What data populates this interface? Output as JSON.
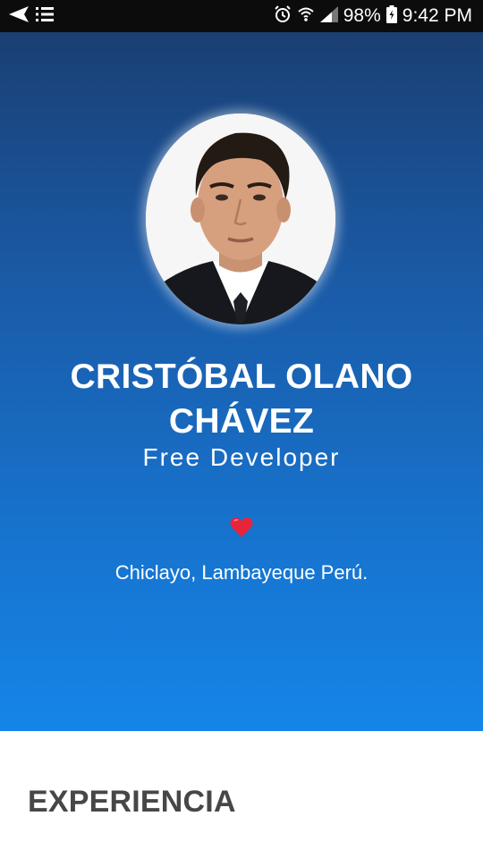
{
  "status_bar": {
    "battery": "98%",
    "time": "9:42 PM",
    "icons": [
      "send-icon",
      "list-icon",
      "alarm-icon",
      "wifi-icon",
      "signal-icon",
      "battery-icon"
    ]
  },
  "profile": {
    "name_line1": "CRISTÓBAL OLANO",
    "name_line2": "CHÁVEZ",
    "role": "Free Developer",
    "heart_icon": "heart-icon",
    "location": "Chiclayo, Lambayeque Perú."
  },
  "sections": {
    "experience_title": "EXPERIENCIA"
  },
  "colors": {
    "status_bar": "#0c0c0c",
    "hero_top": "#1a3f73",
    "hero_bottom": "#1585e8",
    "heart": "#e8233c",
    "section_title": "#474747"
  }
}
